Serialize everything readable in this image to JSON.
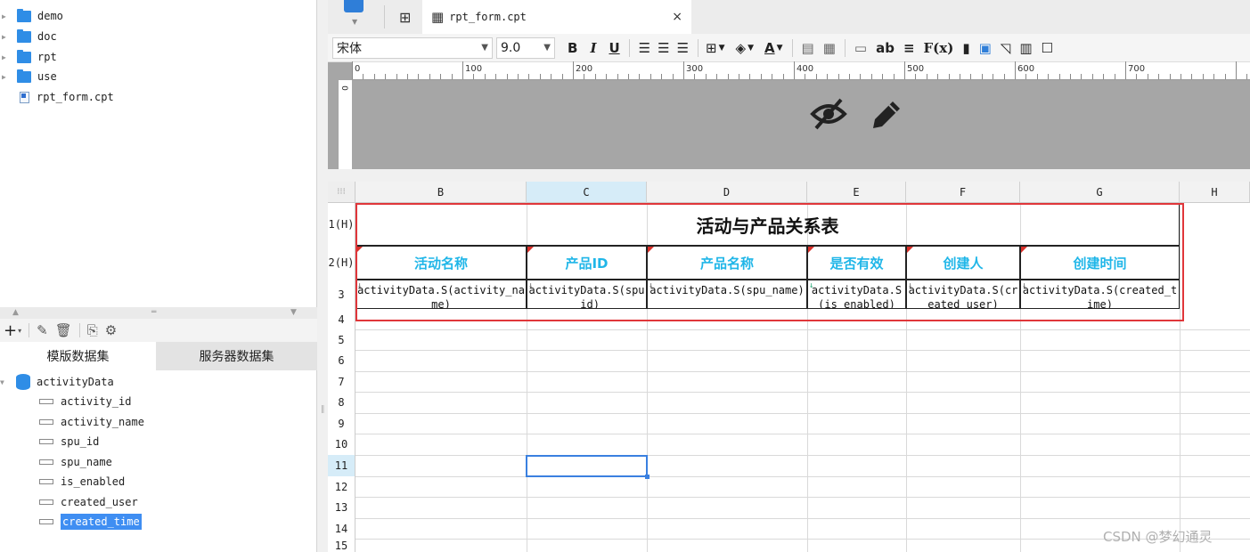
{
  "file_tree": [
    {
      "label": "demo",
      "type": "folder"
    },
    {
      "label": "doc",
      "type": "folder"
    },
    {
      "label": "rpt",
      "type": "folder"
    },
    {
      "label": "use",
      "type": "folder"
    },
    {
      "label": "rpt_form.cpt",
      "type": "file"
    }
  ],
  "dataset_tabs": {
    "template": "模版数据集",
    "server": "服务器数据集"
  },
  "dataset": {
    "name": "activityData",
    "fields": [
      "activity_id",
      "activity_name",
      "spu_id",
      "spu_name",
      "is_enabled",
      "created_user",
      "created_time"
    ],
    "selected_field": "created_time"
  },
  "editor_tab": {
    "label": "rpt_form.cpt",
    "close": "×"
  },
  "format": {
    "font": "宋体",
    "size": "9.0",
    "bold": "B",
    "italic": "I",
    "underline": "U",
    "text_tool": "ab",
    "formula_tool": "F(x)"
  },
  "ruler": {
    "marks": [
      "0",
      "100",
      "200",
      "300",
      "400",
      "500",
      "600",
      "700"
    ],
    "vertical": "0"
  },
  "columns": [
    "B",
    "C",
    "D",
    "E",
    "F",
    "G",
    "H"
  ],
  "selected_column": "C",
  "rows": [
    "1(H)",
    "2(H)",
    "3",
    "4",
    "5",
    "6",
    "7",
    "8",
    "9",
    "10",
    "11",
    "12",
    "13",
    "14",
    "15"
  ],
  "selected_row": "11",
  "report": {
    "title": "活动与产品关系表",
    "headers": [
      "活动名称",
      "产品ID",
      "产品名称",
      "是否有效",
      "创建人",
      "创建时间"
    ],
    "cells": [
      "activityData.S(activity_name)",
      "activityData.S(spu_id)",
      "activityData.S(spu_name)",
      "activityData.S(is_enabled)",
      "activityData.S(created_user)",
      "activityData.S(created_time)"
    ]
  },
  "watermark": "CSDN @梦幻通灵",
  "colors": {
    "accent": "#2f8de6",
    "header_text": "#20b6e8",
    "frame": "#e0363a",
    "selection": "#3a80e0"
  }
}
